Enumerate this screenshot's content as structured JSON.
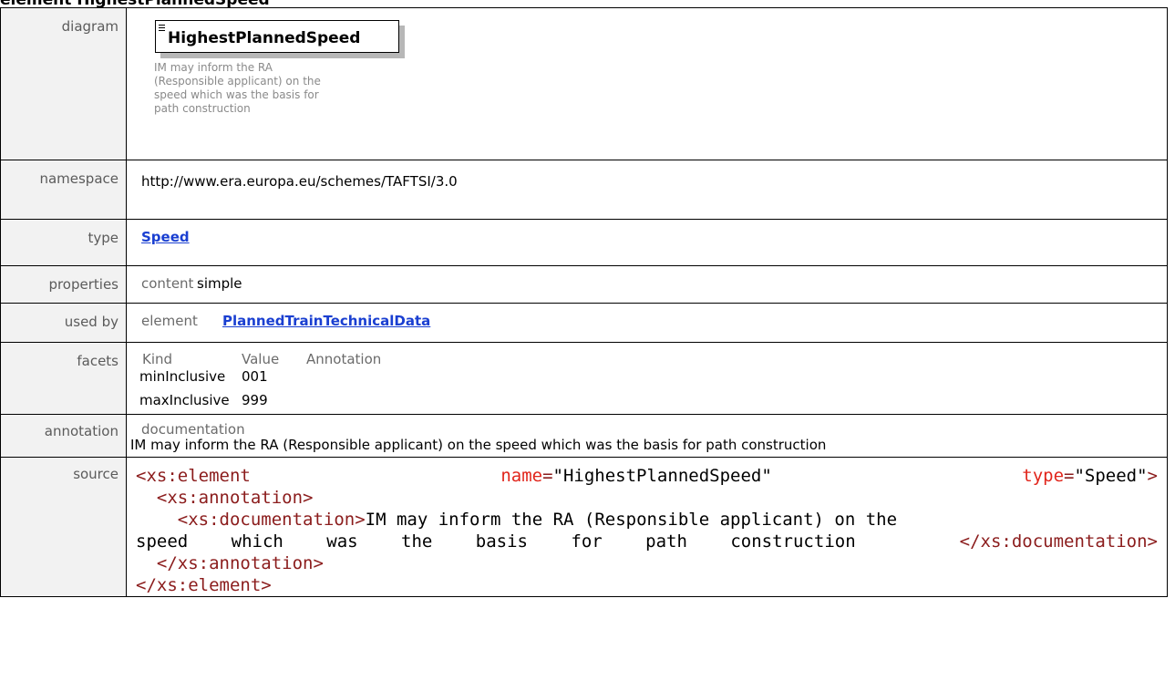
{
  "heading": "element HighestPlannedSpeed",
  "rows": {
    "diagram": {
      "label": "diagram",
      "element_name": "HighestPlannedSpeed",
      "annotation_lines": [
        "IM may inform the RA",
        "(Responsible applicant) on the",
        "speed which was the basis for",
        "path construction"
      ]
    },
    "namespace": {
      "label": "namespace",
      "value": "http://www.era.europa.eu/schemes/TAFTSI/3.0"
    },
    "type": {
      "label": "type",
      "value": "Speed"
    },
    "properties": {
      "label": "properties",
      "key": "content",
      "value": "simple"
    },
    "used_by": {
      "label": "used by",
      "key": "element",
      "value": "PlannedTrainTechnicalData"
    },
    "facets": {
      "label": "facets",
      "headers": [
        "Kind",
        "Value",
        "Annotation"
      ],
      "rows": [
        {
          "kind": "minInclusive",
          "value": "001"
        },
        {
          "kind": "maxInclusive",
          "value": "999"
        }
      ]
    },
    "annotation": {
      "label": "annotation",
      "key": "documentation",
      "text": "IM may inform the RA (Responsible applicant) on the speed which was the basis for path construction"
    },
    "source": {
      "label": "source",
      "line1": {
        "open": "<xs:element",
        "name_attr": "name",
        "name_val": "\"HighestPlannedSpeed\"",
        "type_attr": "type",
        "type_val": "\"Speed\"",
        "close": ">"
      },
      "line2": "<xs:annotation>",
      "line3_open": "<xs:documentation>",
      "line3_text": "IM may inform the RA (Responsible applicant) on the",
      "line4_text": "speed which was the basis for path construction",
      "line4_close": "</xs:documentation>",
      "line5": "</xs:annotation>",
      "line6": "</xs:element>"
    }
  },
  "colors": {
    "label_bg": "#f2f2f2",
    "link": "#1a3fd1",
    "xml_tag": "#8b1c1c",
    "xml_attr": "#e1251b"
  }
}
